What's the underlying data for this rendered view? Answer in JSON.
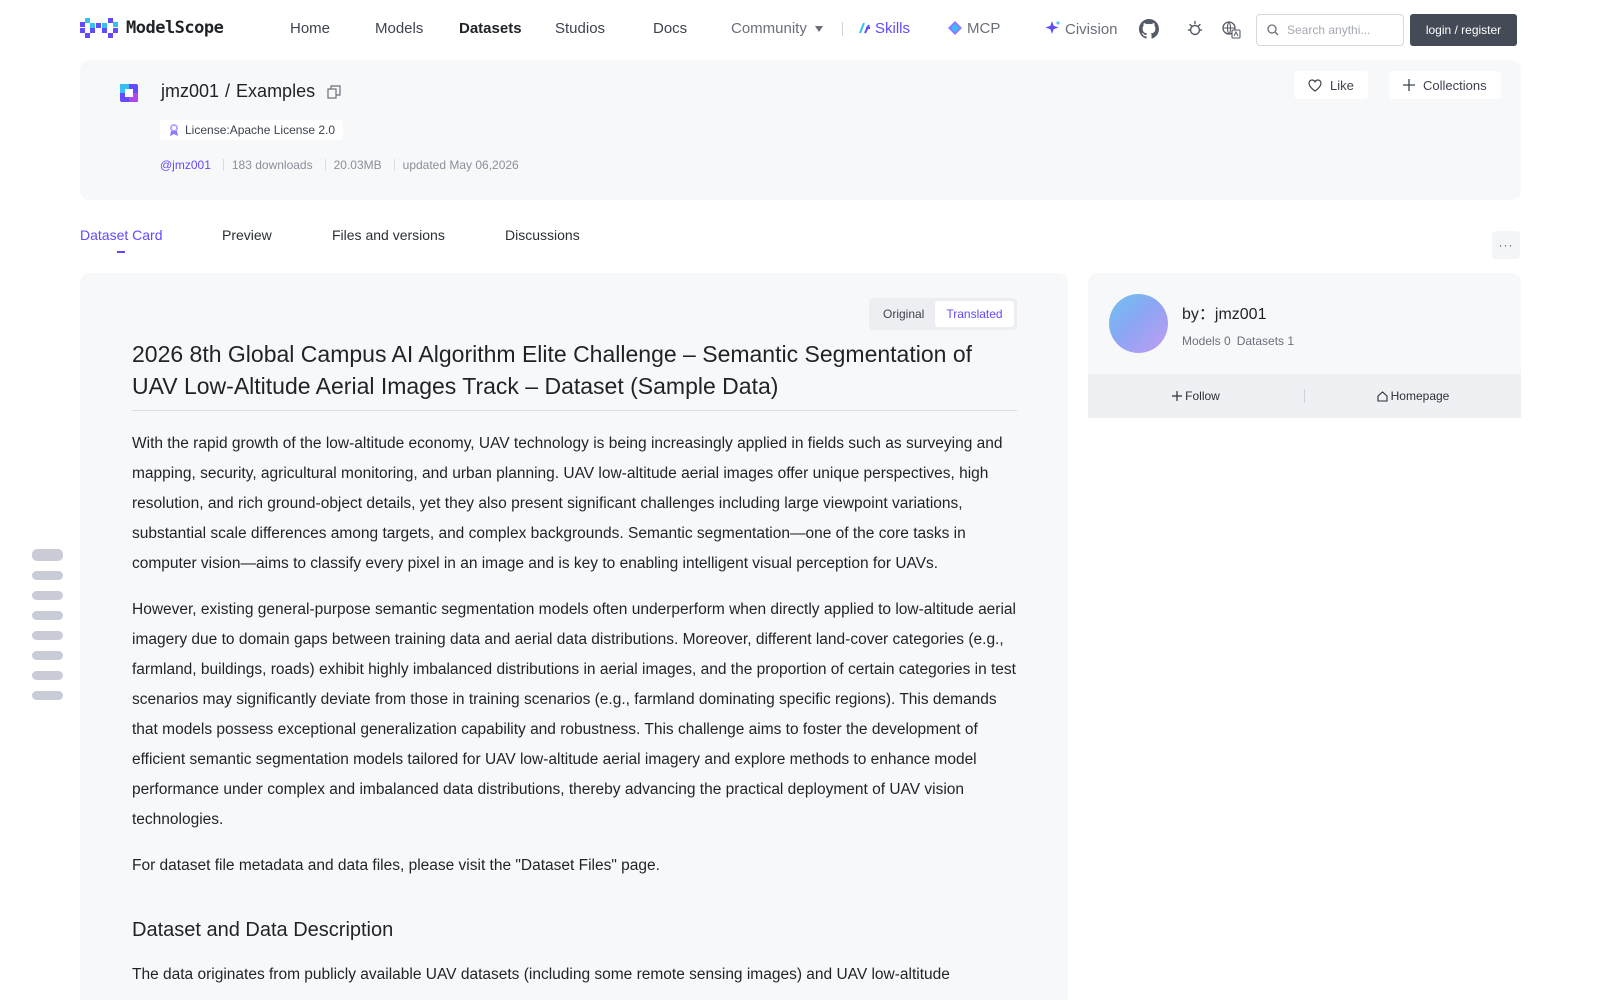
{
  "nav": {
    "brand": "ModelScope",
    "links": {
      "home": "Home",
      "models": "Models",
      "datasets": "Datasets",
      "studios": "Studios",
      "docs": "Docs",
      "community": "Community",
      "skills": "Skills",
      "mcp": "MCP",
      "civision": "Civision"
    },
    "search_placeholder": "Search anythi...",
    "login_label": "login / register",
    "active": "Datasets"
  },
  "dataset": {
    "owner": "jmz001",
    "slash": "/",
    "name": "Examples",
    "license": "License:Apache License 2.0",
    "author_handle": "@jmz001",
    "downloads": "183 downloads",
    "size": "20.03MB",
    "updated": "updated May 06,2026",
    "like_label": "Like",
    "collections_label": "Collections"
  },
  "tabs": [
    "Dataset Card",
    "Preview",
    "Files and versions",
    "Discussions"
  ],
  "active_tab": "Dataset Card",
  "more_label": "···",
  "view_toggle": {
    "original": "Original",
    "translated": "Translated",
    "selected": "Translated"
  },
  "doc": {
    "title": "2026 8th Global Campus AI Algorithm Elite Challenge – Semantic Segmentation of UAV Low-Altitude Aerial Images Track – Dataset (Sample Data)",
    "paragraphs": [
      "With the rapid growth of the low-altitude economy, UAV technology is being increasingly applied in fields such as surveying and mapping, security, agricultural monitoring, and urban planning. UAV low-altitude aerial images offer unique perspectives, high resolution, and rich ground-object details, yet they also present significant challenges including large viewpoint variations, substantial scale differences among targets, and complex backgrounds. Semantic segmentation—one of the core tasks in computer vision—aims to classify every pixel in an image and is key to enabling intelligent visual perception for UAVs.",
      "However, existing general-purpose semantic segmentation models often underperform when directly applied to low-altitude aerial imagery due to domain gaps between training data and aerial data distributions. Moreover, different land-cover categories (e.g., farmland, buildings, roads) exhibit highly imbalanced distributions in aerial images, and the proportion of certain categories in test scenarios may significantly deviate from those in training scenarios (e.g., farmland dominating specific regions). This demands that models possess exceptional generalization capability and robustness. This challenge aims to foster the development of efficient semantic segmentation models tailored for UAV low-altitude aerial imagery and explore methods to enhance model performance under complex and imbalanced data distributions, thereby advancing the practical deployment of UAV vision technologies.",
      "For dataset file metadata and data files, please visit the \"Dataset Files\" page."
    ],
    "section_heading": "Dataset and Data Description",
    "section_text": "The data originates from publicly available UAV datasets (including some remote sensing images) and UAV low-altitude"
  },
  "author_card": {
    "by_label": "by：jmz001",
    "models": "Models 0",
    "datasets": "Datasets 1",
    "follow_label": "Follow",
    "homepage_label": "Homepage"
  },
  "colors": {
    "accent": "#624aff",
    "panel": "#f7f8fa",
    "login_bg": "#454a57"
  },
  "icons": [
    "search-icon",
    "github-icon",
    "theme-icon",
    "translate-icon",
    "heart-icon",
    "plus-icon",
    "copy-icon",
    "license-icon",
    "home-icon",
    "sparkle-icon",
    "skills-icon",
    "mcp-icon"
  ]
}
